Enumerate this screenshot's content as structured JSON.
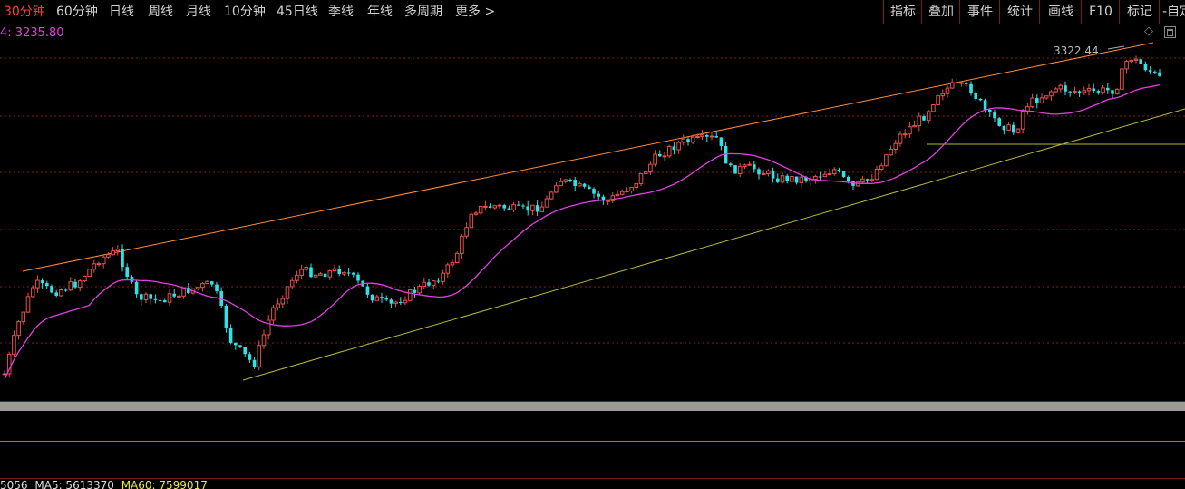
{
  "toolbar": {
    "tabs": [
      {
        "label": "30分钟",
        "active": true
      },
      {
        "label": "60分钟"
      },
      {
        "label": "日线"
      },
      {
        "label": "周线"
      },
      {
        "label": "月线"
      },
      {
        "label": "10分钟"
      },
      {
        "label": "45日线"
      },
      {
        "label": "季线"
      },
      {
        "label": "年线"
      },
      {
        "label": "多周期"
      },
      {
        "label": "更多 >"
      }
    ],
    "right_buttons": [
      "指标",
      "叠加",
      "事件",
      "统计",
      "画线",
      "F10",
      "标记",
      "-自定"
    ]
  },
  "ma_legend": "4: 3235.80",
  "high_label": "3322.44",
  "volume_legend": {
    "v1": "5056",
    "ma5": "MA5: 5613370",
    "ma60": "MA60: 7599017"
  },
  "colors": {
    "up": "#e8504a",
    "down": "#2fe2e8",
    "ma": "#e040e0",
    "resistance": "#ff8c3a",
    "support": "#b8b83a",
    "grid": "#8a1a1a",
    "active_tab": "#ff3b3b"
  }
}
